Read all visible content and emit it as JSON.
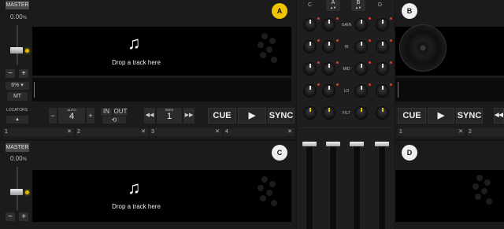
{
  "colors": {
    "accent": "#f0c400",
    "led": "#e03a2a",
    "bg": "#151515"
  },
  "deck_a": {
    "letter": "A",
    "master": "MASTER",
    "pitch": "0.00",
    "pitch_unit": "%",
    "range": "6%",
    "range_arrow": "▾",
    "mt": "MT",
    "drop": "Drop a track here",
    "note_icon": "♫",
    "minus": "−",
    "plus": "+",
    "locators": "LOCATORS",
    "loc_arrow": "▲",
    "loop_minus": "−",
    "loop_label": "AUTO",
    "loop_value": "4",
    "loop_plus": "+",
    "in": "IN",
    "out": "OUT",
    "loop_icon": "⟲",
    "seek_label": "SEEK",
    "seek_value": "1",
    "seek_back": "◀◀",
    "seek_fwd": "▶▶",
    "cue": "CUE",
    "play": "▶",
    "sync": "SYNC",
    "hotcues": [
      {
        "n": "1",
        "x": "✕"
      },
      {
        "n": "2",
        "x": "✕"
      },
      {
        "n": "3",
        "x": "✕"
      },
      {
        "n": "4",
        "x": "✕"
      }
    ]
  },
  "deck_c": {
    "letter": "C",
    "master": "MASTER",
    "pitch": "0.00",
    "pitch_unit": "%",
    "drop": "Drop a track here",
    "note_icon": "♫",
    "minus": "−",
    "plus": "+"
  },
  "deck_b": {
    "letter": "B",
    "cue": "CUE",
    "play": "▶",
    "sync": "SYNC",
    "back": "◀◀",
    "hotcues": [
      {
        "n": "1",
        "x": "✕"
      },
      {
        "n": "2",
        "x": ""
      }
    ]
  },
  "deck_d": {
    "letter": "D"
  },
  "mixer": {
    "ch_c": "C",
    "ch_a": "A",
    "ch_b": "B",
    "ch_d": "D",
    "ch_a_arrows": "▲▼",
    "ch_b_arrows": "▲▼",
    "eq": [
      "GAIN",
      "HI",
      "MID",
      "LO",
      "FILT"
    ]
  }
}
